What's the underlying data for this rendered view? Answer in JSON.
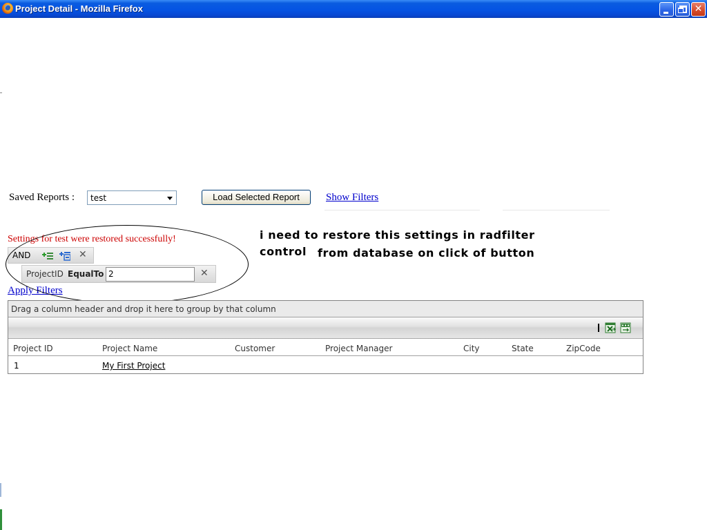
{
  "window": {
    "title": "Project Detail - Mozilla Firefox",
    "min_glyph": "",
    "close_glyph": "✕"
  },
  "reports": {
    "label": "Saved Reports :",
    "selected": "test",
    "load_button": "Load Selected Report",
    "show_filters": "Show Filters"
  },
  "filter": {
    "restored_message": "Settings for test were restored successfully!",
    "group_operator": "AND",
    "remove_glyph": "✕",
    "expression": {
      "field": "ProjectID",
      "operator": "EqualTo",
      "value": "2"
    },
    "apply_link": "Apply Filters"
  },
  "annotation": {
    "line1": "i need to restore this settings in radfilter",
    "line2a": "control",
    "line2b": "from database on click of button"
  },
  "grid": {
    "group_panel_text": "Drag a column header and drop it here to group by that column",
    "columns": [
      "Project ID",
      "Project Name",
      "Customer",
      "Project Manager",
      "City",
      "State",
      "ZipCode"
    ],
    "rows": [
      {
        "project_id": "1",
        "project_name": "My First Project",
        "customer": "",
        "project_manager": "",
        "city": "",
        "state": "",
        "zipcode": ""
      }
    ]
  },
  "colors": {
    "titlebar": "#0554e3",
    "link": "#0000cc",
    "message": "#cc0000"
  }
}
